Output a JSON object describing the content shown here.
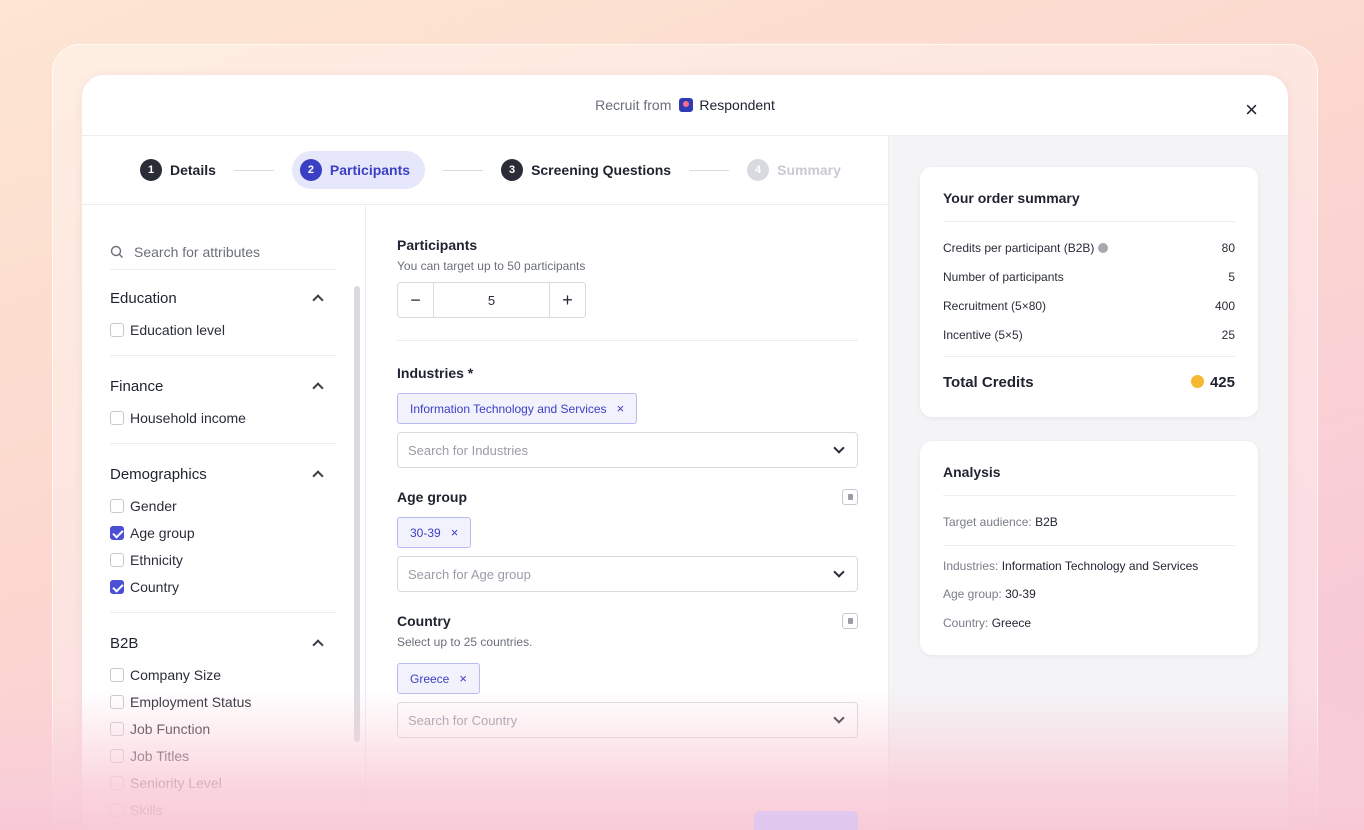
{
  "header": {
    "prefix": "Recruit from",
    "brand": "Respondent",
    "close": "×"
  },
  "steps": [
    {
      "num": "1",
      "label": "Details"
    },
    {
      "num": "2",
      "label": "Participants"
    },
    {
      "num": "3",
      "label": "Screening Questions"
    },
    {
      "num": "4",
      "label": "Summary"
    }
  ],
  "sidebar": {
    "search_placeholder": "Search for attributes",
    "groups": [
      {
        "title": "Education",
        "items": [
          {
            "label": "Education level",
            "checked": false
          }
        ]
      },
      {
        "title": "Finance",
        "items": [
          {
            "label": "Household income",
            "checked": false
          }
        ]
      },
      {
        "title": "Demographics",
        "items": [
          {
            "label": "Gender",
            "checked": false
          },
          {
            "label": "Age group",
            "checked": true
          },
          {
            "label": "Ethnicity",
            "checked": false
          },
          {
            "label": "Country",
            "checked": true
          }
        ]
      },
      {
        "title": "B2B",
        "items": [
          {
            "label": "Company Size",
            "checked": false
          },
          {
            "label": "Employment Status",
            "checked": false
          },
          {
            "label": "Job Function",
            "checked": false
          },
          {
            "label": "Job Titles",
            "checked": false
          },
          {
            "label": "Seniority Level",
            "checked": false
          },
          {
            "label": "Skills",
            "checked": false
          }
        ]
      }
    ]
  },
  "participants": {
    "title": "Participants",
    "subtitle": "You can target up to 50 participants",
    "minus": "−",
    "value": "5",
    "plus": "+"
  },
  "industries": {
    "title": "Industries *",
    "chip": "Information Technology and Services",
    "placeholder": "Search for Industries"
  },
  "age_group": {
    "title": "Age group",
    "chip": "30-39",
    "placeholder": "Search for Age group"
  },
  "country": {
    "title": "Country",
    "subtitle": "Select up to 25 countries.",
    "chip": "Greece",
    "placeholder": "Search for Country"
  },
  "chip_remove": "×",
  "order_summary": {
    "title": "Your order summary",
    "rows": [
      {
        "label": "Credits per participant (B2B)",
        "value": "80"
      },
      {
        "label": "Number of participants",
        "value": "5"
      },
      {
        "label": "Recruitment (5×80)",
        "value": "400"
      },
      {
        "label": "Incentive (5×5)",
        "value": "25"
      }
    ],
    "total_label": "Total Credits",
    "total_value": "425"
  },
  "analysis": {
    "title": "Analysis",
    "target_label": "Target audience:",
    "target_value": "B2B",
    "industries_label": "Industries:",
    "industries_value": "Information Technology and Services",
    "age_label": "Age group:",
    "age_value": "30-39",
    "country_label": "Country:",
    "country_value": "Greece"
  },
  "colors": {
    "accent": "#3b3fc4",
    "chip_bg": "#f2f2fd",
    "coin": "#f5b82e"
  }
}
